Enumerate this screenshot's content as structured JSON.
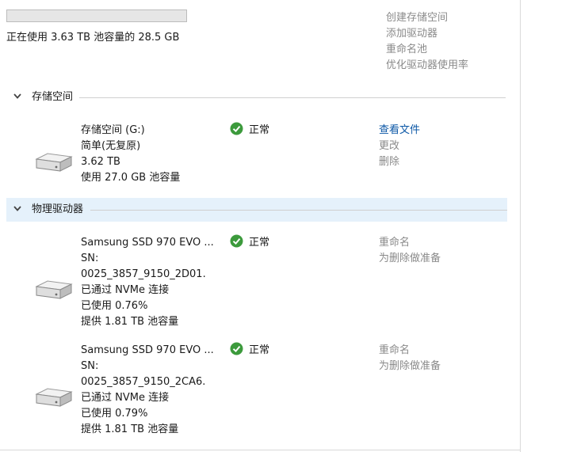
{
  "pool": {
    "usage_fraction": 0.0,
    "usage_text": "正在使用 3.63 TB 池容量的 28.5 GB"
  },
  "top_actions": {
    "create_space": "创建存储空间",
    "add_drives": "添加驱动器",
    "rename_pool": "重命名池",
    "optimize_usage": "优化驱动器使用率"
  },
  "storage_section": {
    "title": "存储空间",
    "space": {
      "name": "存储空间 (G:)",
      "resiliency": "简单(无复原)",
      "size": "3.62 TB",
      "pool_usage": "使用 27.0 GB 池容量",
      "status": "正常",
      "view_files": "查看文件",
      "change": "更改",
      "delete": "删除"
    }
  },
  "physical_section": {
    "title": "物理驱动器",
    "drives": [
      {
        "name": "Samsung SSD 970 EVO ...",
        "sn_label": "SN:",
        "sn": "0025_3857_9150_2D01.",
        "connection": "已通过 NVMe 连接",
        "used": "已使用 0.76%",
        "capacity": "提供 1.81 TB 池容量",
        "status": "正常",
        "rename": "重命名",
        "prepare_remove": "为删除做准备"
      },
      {
        "name": "Samsung SSD 970 EVO ...",
        "sn_label": "SN:",
        "sn": "0025_3857_9150_2CA6.",
        "connection": "已通过 NVMe 连接",
        "used": "已使用 0.79%",
        "capacity": "提供 1.81 TB 池容量",
        "status": "正常",
        "rename": "重命名",
        "prepare_remove": "为删除做准备"
      }
    ]
  },
  "colors": {
    "link_blue": "#0b57a6",
    "link_gray": "#8a8a8a",
    "status_green": "#3c9a3c",
    "header_highlight": "#e5f1fb"
  },
  "icons": {
    "drive": "hard-drive-icon",
    "status_ok": "check-circle-icon",
    "collapse": "chevron-down-icon"
  }
}
